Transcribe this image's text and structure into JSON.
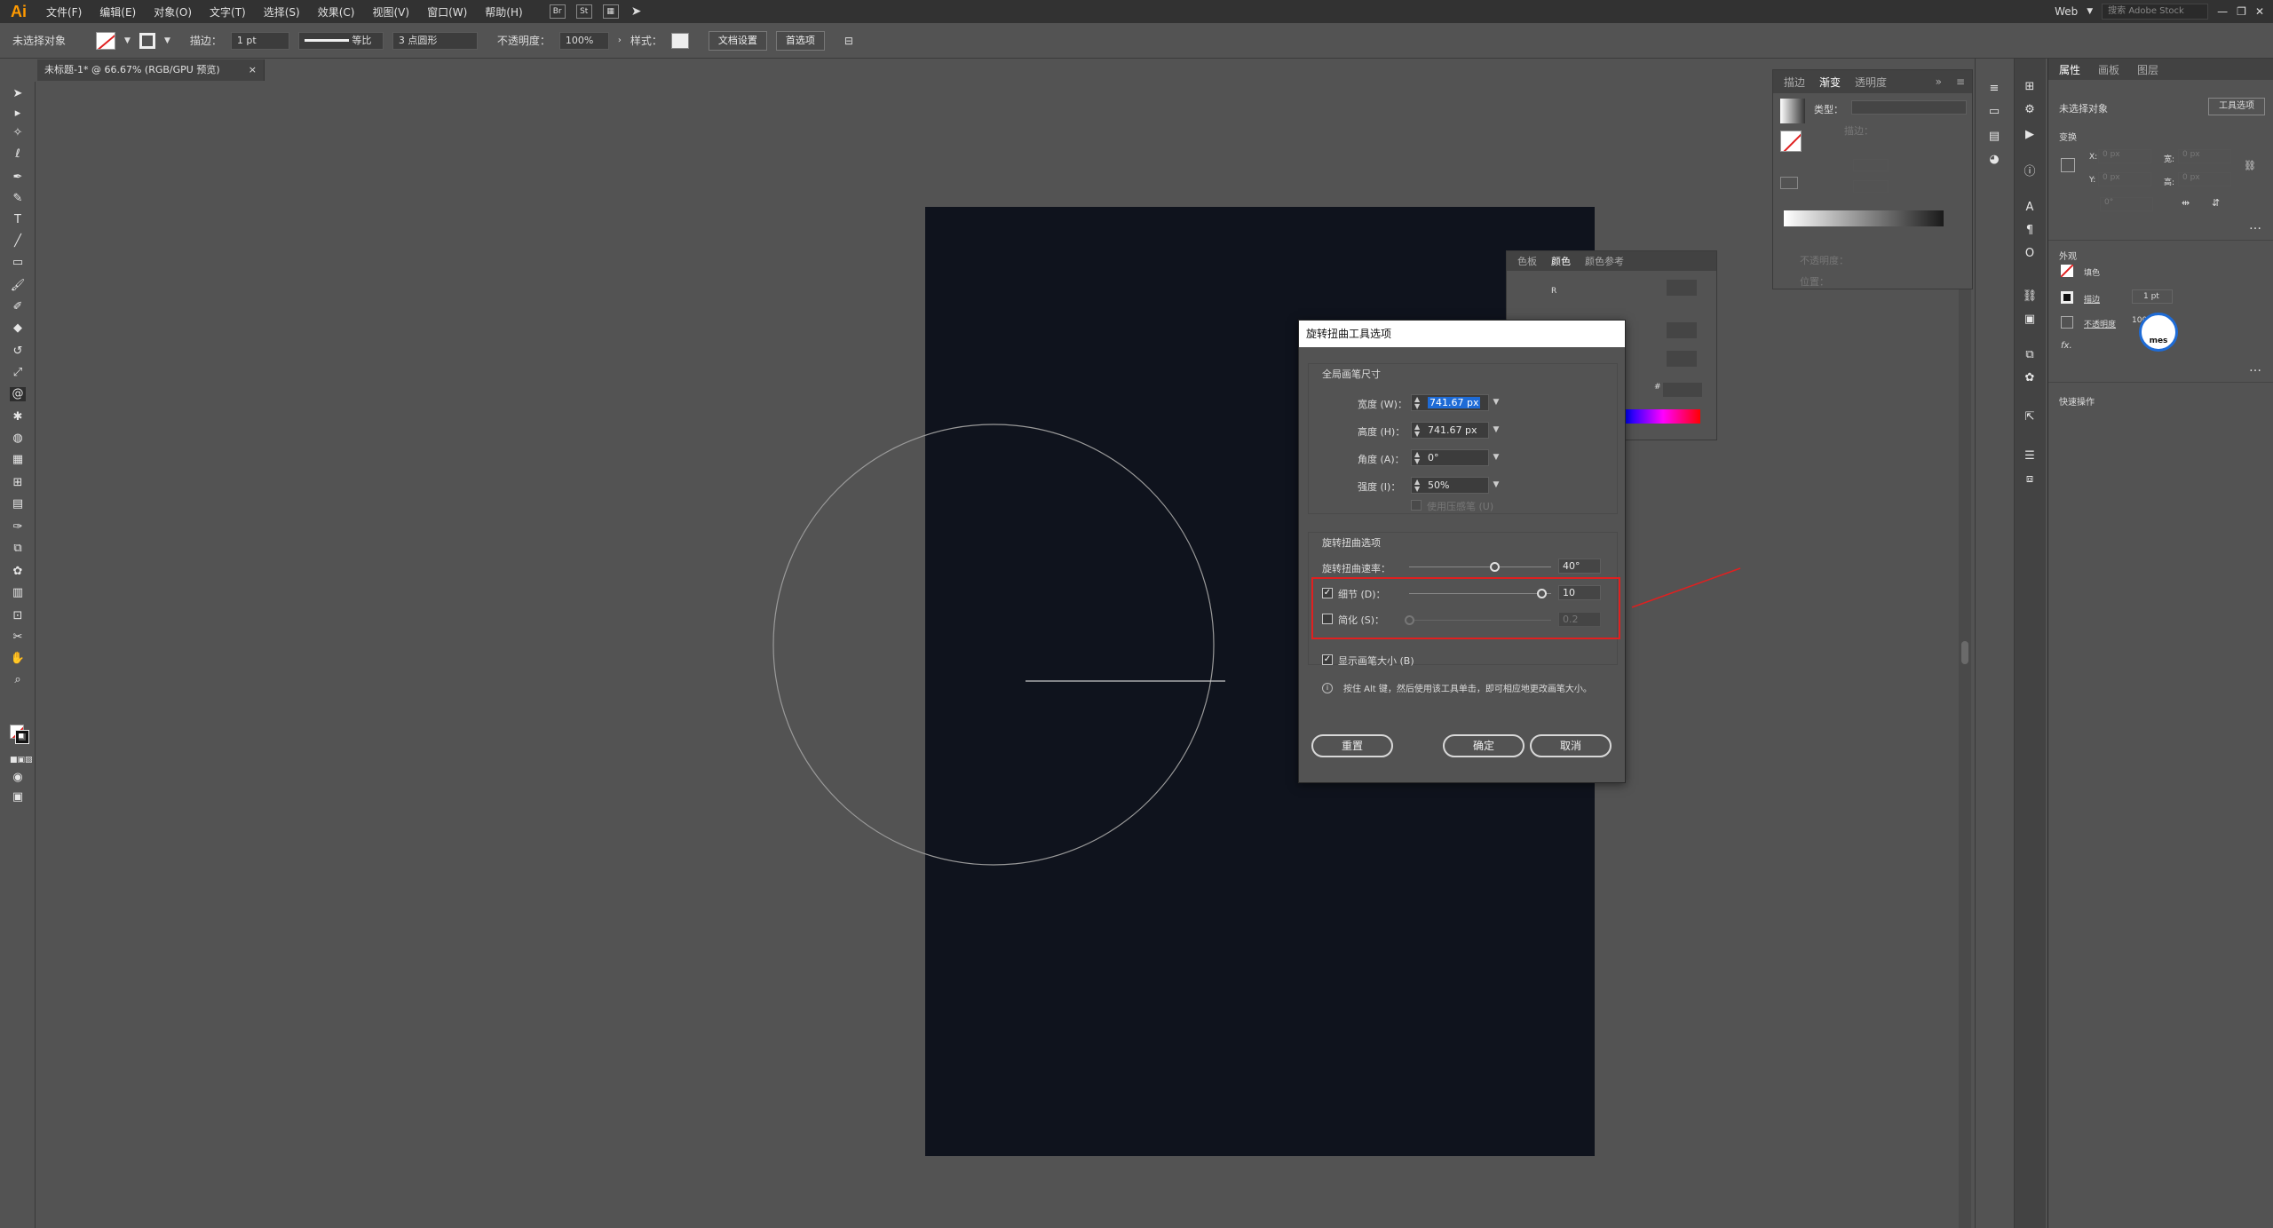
{
  "app": {
    "logo": "Ai",
    "workspace": "Web",
    "search_placeholder": "搜索 Adobe Stock"
  },
  "menu": [
    "文件(F)",
    "编辑(E)",
    "对象(O)",
    "文字(T)",
    "选择(S)",
    "效果(C)",
    "视图(V)",
    "窗口(W)",
    "帮助(H)"
  ],
  "menu_icons": {
    "br": "Br",
    "st": "St"
  },
  "control_bar": {
    "selection": "未选择对象",
    "stroke_label": "描边：",
    "stroke_value": "1 pt",
    "uniform": "等比",
    "brush": "3 点圆形",
    "opacity_label": "不透明度：",
    "opacity_value": "100%",
    "style_label": "样式：",
    "doc_setup": "文档设置",
    "preferences": "首选项"
  },
  "document_tab": {
    "title": "未标题-1* @ 66.67% (RGB/GPU 预览)",
    "close": "×"
  },
  "gradient_panel": {
    "tabs": [
      "描边",
      "渐变",
      "透明度"
    ],
    "type_label": "类型：",
    "stroke_label": "描边：",
    "opacity_label": "不透明度：",
    "position_label": "位置："
  },
  "color_panel": {
    "tabs": [
      "色板",
      "颜色",
      "颜色参考"
    ],
    "r_label": "R",
    "hex_label": "#"
  },
  "properties": {
    "tabs": [
      "属性",
      "画板",
      "图层"
    ],
    "no_selection": "未选择对象",
    "tool_options_btn": "工具选项",
    "transform_label": "变换",
    "x_label": "X:",
    "y_label": "Y:",
    "w_label": "宽:",
    "h_label": "高:",
    "x_value": "0 px",
    "y_value": "0 px",
    "w_value": "0 px",
    "h_value": "0 px",
    "angle_value": "0°",
    "appearance_label": "外观",
    "fill_label": "填色",
    "stroke_label": "描边",
    "stroke_value": "1 pt",
    "opacity_label": "不透明度",
    "opacity_value": "100%",
    "fx_label": "fx.",
    "quick_actions": "快速操作",
    "avatar_text": "mes"
  },
  "dialog": {
    "title": "旋转扭曲工具选项",
    "global_brush_title": "全局画笔尺寸",
    "width_label": "宽度 (W)：",
    "width_value": "741.67 px",
    "height_label": "高度 (H)：",
    "height_value": "741.67 px",
    "angle_label": "角度 (A)：",
    "angle_value": "0°",
    "intensity_label": "强度 (I)：",
    "intensity_value": "50%",
    "pressure_label": "使用压感笔 (U)",
    "twirl_title": "旋转扭曲选项",
    "rate_label": "旋转扭曲速率：",
    "rate_value": "40°",
    "detail_label": "细节 (D)：",
    "detail_value": "10",
    "simplify_label": "简化 (S)：",
    "simplify_value": "0.2",
    "show_size_label": "显示画笔大小 (B)",
    "hint": "按住 Alt 键，然后使用该工具单击，即可相应地更改画笔大小。",
    "reset_btn": "重置",
    "ok_btn": "确定",
    "cancel_btn": "取消",
    "rate_level": 0.6,
    "detail_level": 0.93,
    "simplify_level": 0.0
  },
  "colors": {
    "artboard": "#0f131d",
    "highlight": "#e02020",
    "ui_bg": "#535353",
    "menubar": "#323232"
  }
}
